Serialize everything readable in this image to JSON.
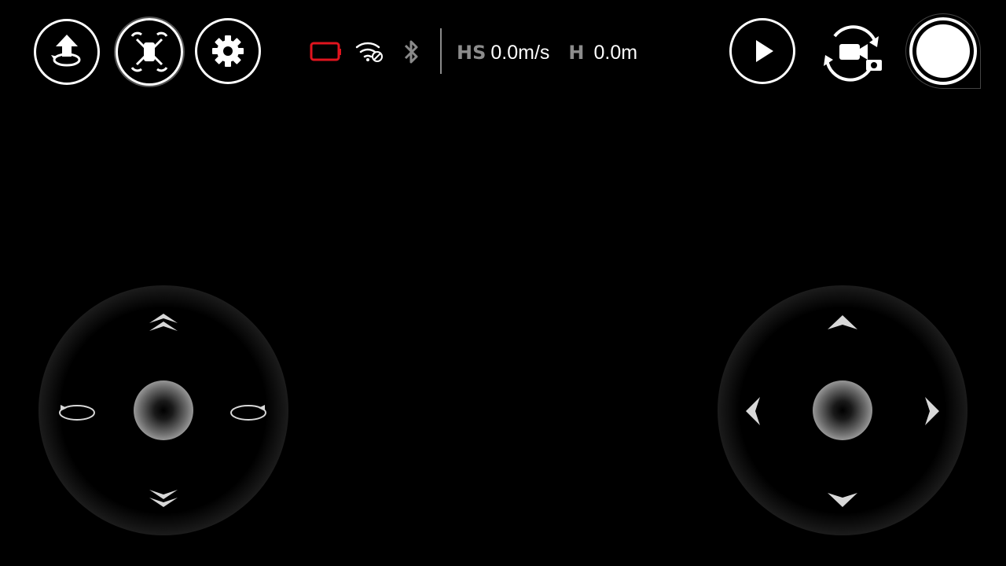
{
  "toolbar_left": {
    "takeoff_icon": "takeoff-icon",
    "drone_mode_icon": "drone-icon",
    "settings_icon": "gear-icon"
  },
  "status": {
    "battery_icon": "battery-icon",
    "battery_color": "#e0141e",
    "wifi_icon": "wifi-icon",
    "bluetooth_icon": "bluetooth-icon"
  },
  "telemetry": {
    "hs_label": "HS",
    "hs_value": "0.0m/s",
    "h_label": "H",
    "h_value": "0.0m"
  },
  "toolbar_right": {
    "playback_icon": "play-icon",
    "camera_mode_icon": "switch-camera-icon",
    "shutter_icon": "shutter-icon"
  },
  "joysticks": {
    "left": {
      "name": "throttle-yaw",
      "icons": [
        "double-chevron-up-icon",
        "rotate-left-icon",
        "rotate-right-icon",
        "double-chevron-down-icon"
      ]
    },
    "right": {
      "name": "pitch-roll",
      "icons": [
        "triangle-up-icon",
        "triangle-left-icon",
        "triangle-right-icon",
        "triangle-down-icon"
      ]
    }
  }
}
